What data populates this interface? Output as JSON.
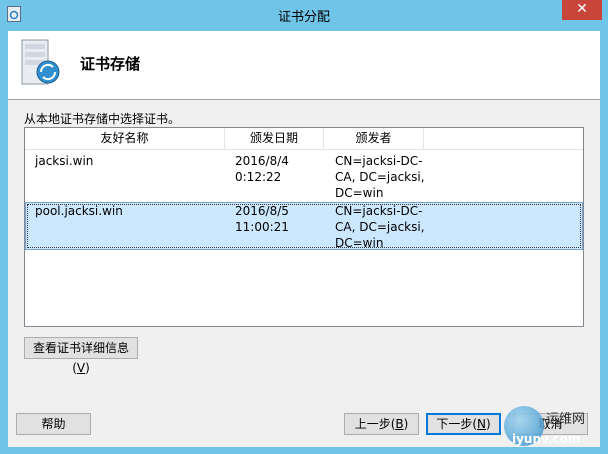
{
  "window": {
    "title": "证书分配",
    "close_glyph": "✕"
  },
  "header": {
    "title": "证书存储",
    "icon": "certificate-store-icon"
  },
  "instruction": "从本地证书存储中选择证书。",
  "table": {
    "columns": [
      "友好名称",
      "颁发日期",
      "颁发者"
    ],
    "rows": [
      {
        "name": "jacksi.win",
        "issued": "2016/8/4\n0:12:22",
        "issuer": "CN=jacksi-DC-\nCA, DC=jacksi,\nDC=win",
        "selected": false
      },
      {
        "name": "pool.jacksi.win",
        "issued": "2016/8/5\n11:00:21",
        "issuer": "CN=jacksi-DC-\nCA, DC=jacksi,\nDC=win",
        "selected": true
      }
    ]
  },
  "buttons": {
    "view_details": {
      "label": "查看证书详细信息(",
      "accel": "V",
      "suffix": ")"
    },
    "help": "帮助",
    "back": {
      "label": "上一步(",
      "accel": "B",
      "suffix": ")"
    },
    "next": {
      "label": "下一步(",
      "accel": "N",
      "suffix": ")"
    },
    "cancel": "取消"
  },
  "watermark": {
    "line1": "运维网",
    "line2": "iyunv.com"
  },
  "colors": {
    "titlebar": "#6fc4e8",
    "close": "#c9453a",
    "selection": "#cce8ff",
    "default_button_border": "#0078d7"
  }
}
